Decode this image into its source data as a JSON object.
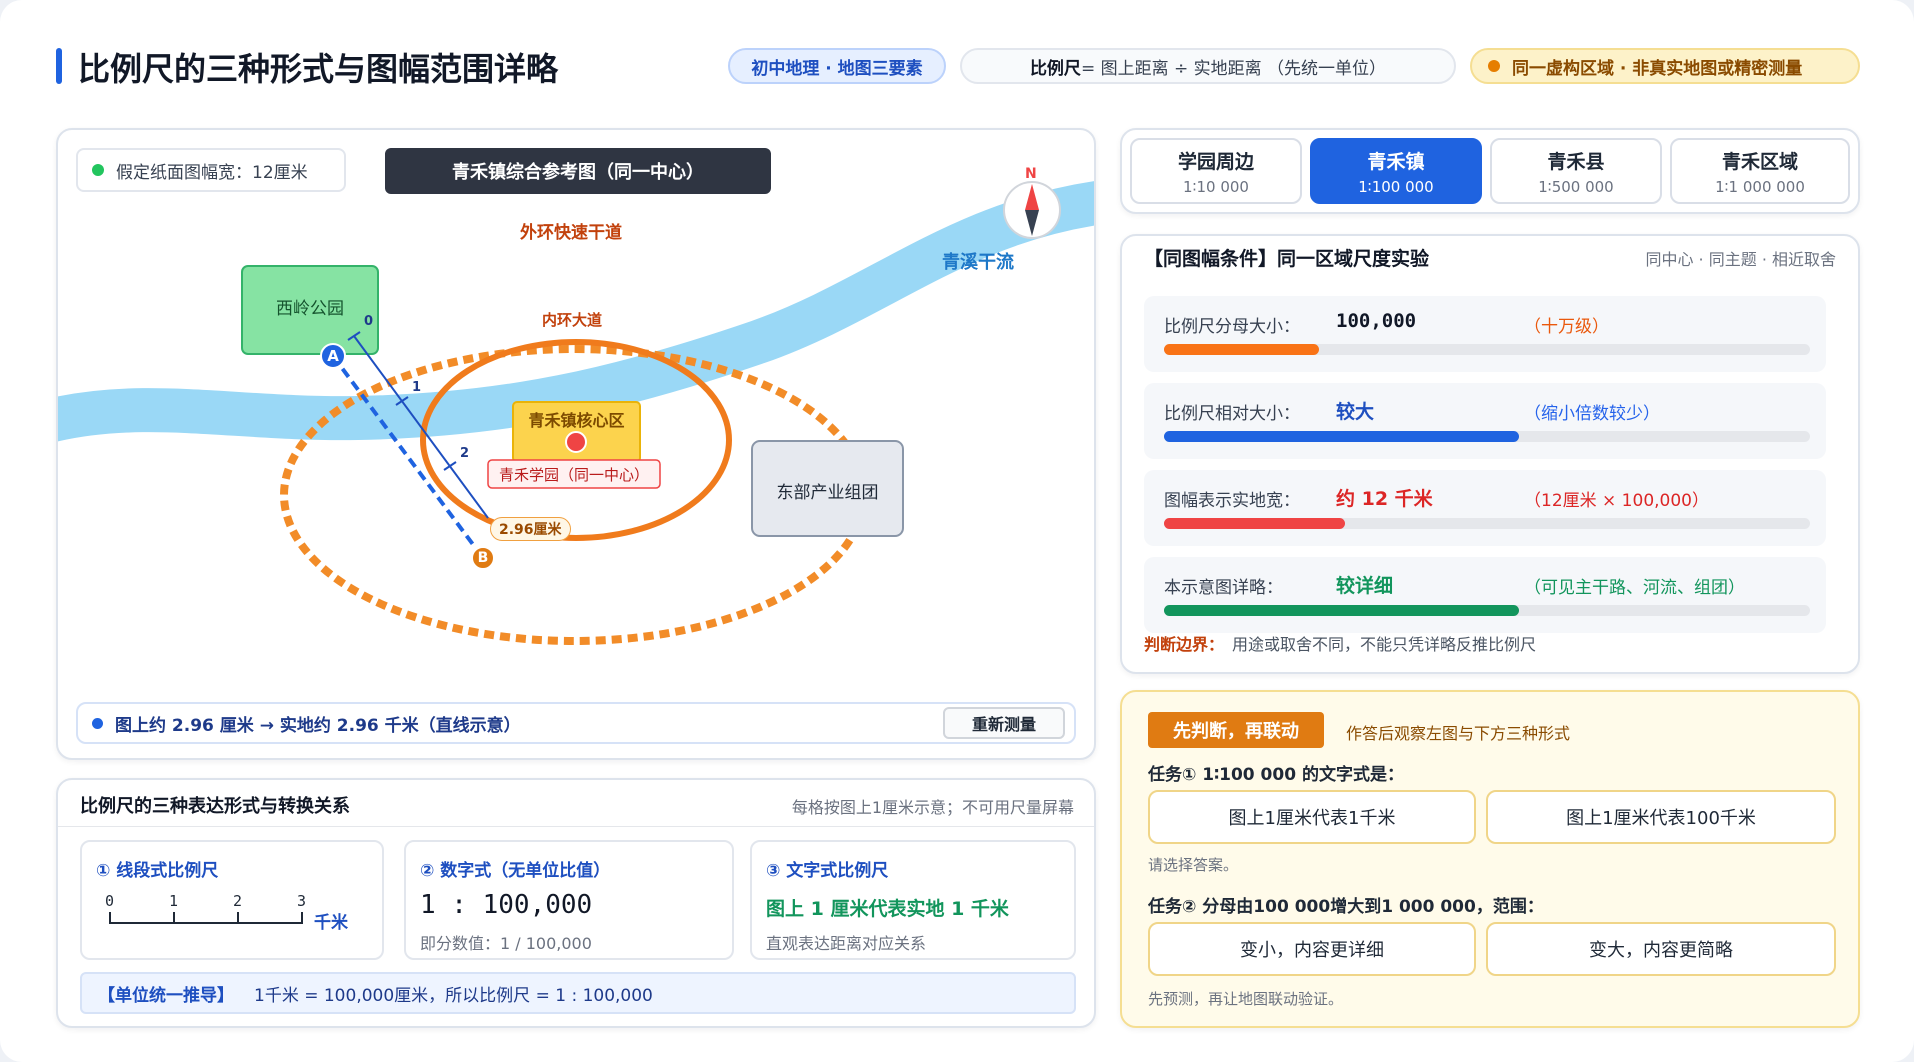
{
  "header": {
    "title": "比例尺的三种形式与图幅范围详略",
    "tag_topic": "初中地理 · 地图三要素",
    "formula_strong": "比例尺",
    "formula_rest": " = 图上距离 ÷ 实地距离 （先统一单位）",
    "disclaimer": "同一虚构区域 · 非真实地图或精密测量"
  },
  "map": {
    "paper_width": "假定纸面图幅宽：12厘米",
    "map_title": "青禾镇综合参考图（同一中心）",
    "compass_n": "N",
    "labels": {
      "river": "青溪干流",
      "outer_ring": "外环快速干道",
      "inner_ring": "内环大道",
      "park": "西岭公园",
      "core": "青禾镇核心区",
      "school": "青禾学园（同一中心）",
      "east": "东部产业组团",
      "point_a": "A",
      "point_b": "B",
      "measure": "2.96厘米",
      "ruler_ticks": [
        "0",
        "1",
        "2"
      ]
    },
    "result_text": "图上约 2.96 厘米 → 实地约 2.96 千米（直线示意）",
    "remeasure_button": "重新测量"
  },
  "tabs": [
    {
      "name": "学园周边",
      "scale": "1∶10 000",
      "active": false
    },
    {
      "name": "青禾镇",
      "scale": "1∶100 000",
      "active": true
    },
    {
      "name": "青禾县",
      "scale": "1∶500 000",
      "active": false
    },
    {
      "name": "青禾区域",
      "scale": "1∶1 000 000",
      "active": false
    }
  ],
  "experiment": {
    "title": "【同图幅条件】同一区域尺度实验",
    "subtitle": "同中心 · 同主题 · 相近取舍",
    "rows": [
      {
        "label": "比例尺分母大小：",
        "value": "100,000",
        "note": "（十万级）",
        "color": "#f97316",
        "level": 0.24
      },
      {
        "label": "比例尺相对大小：",
        "value": "较大",
        "note": "（缩小倍数较少）",
        "color": "#1f63e0",
        "level": 0.55
      },
      {
        "label": "图幅表示实地宽：",
        "value": "约 12 千米",
        "note": "（12厘米 × 100,000）",
        "color": "#ef4444",
        "level": 0.28
      },
      {
        "label": "本示意图详略：",
        "value": "较详细",
        "note": "（可见主干路、河流、组团）",
        "color": "#12955c",
        "level": 0.55
      }
    ],
    "boundary_label": "判断边界：",
    "boundary_text": "用途或取舍不同，不能只凭详略反推比例尺"
  },
  "forms": {
    "title": "比例尺的三种表达形式与转换关系",
    "hint": "每格按图上1厘米示意；不可用尺量屏幕",
    "line": {
      "heading": "① 线段式比例尺",
      "ticks": [
        "0",
        "1",
        "2",
        "3"
      ],
      "unit": "千米"
    },
    "numeric": {
      "heading": "② 数字式（无单位比值）",
      "value": "1 : 100,000",
      "sub": "即分数值：1 / 100,000"
    },
    "text": {
      "heading": "③ 文字式比例尺",
      "value": "图上 1 厘米代表实地 1 千米",
      "sub": "直观表达距离对应关系"
    },
    "derive_label": "【单位统一推导】",
    "derive_text": "1千米 = 100,000厘米，所以比例尺 = 1 : 100,000"
  },
  "quiz": {
    "badge": "先判断，再联动",
    "badge_note": "作答后观察左图与下方三种形式",
    "task1": "任务① 1∶100 000 的文字式是：",
    "task1_options": [
      "图上1厘米代表1千米",
      "图上1厘米代表100千米"
    ],
    "task1_hint": "请选择答案。",
    "task2": "任务② 分母由100 000增大到1 000 000，范围：",
    "task2_options": [
      "变小，内容更详细",
      "变大，内容更简略"
    ],
    "task2_hint": "先预测，再让地图联动验证。"
  }
}
